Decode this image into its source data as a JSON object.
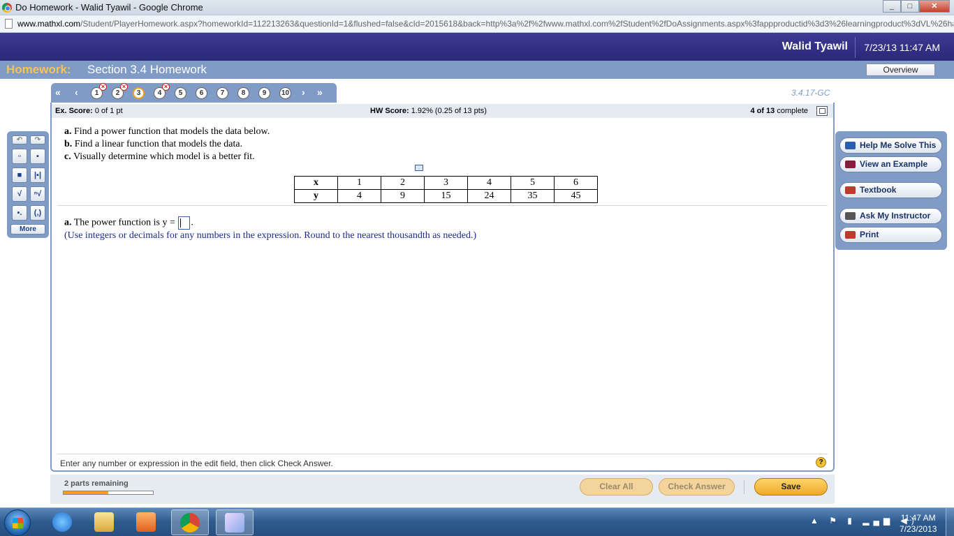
{
  "browser": {
    "window_title": "Do Homework - Walid Tyawil - Google Chrome",
    "url_domain": "www.mathxl.com",
    "url_rest": "/Student/PlayerHomework.aspx?homeworkId=112213263&questionId=1&flushed=false&cId=2015618&back=http%3a%2f%2fwww.mathxl.com%2fStudent%2fDoAssignments.aspx%3fappproductid%3d3%26learningproduct%3dVL%26ha"
  },
  "header": {
    "username": "Walid Tyawil",
    "datetime": "7/23/13 11:47 AM",
    "homework_label": "Homework:",
    "homework_title": "Section 3.4 Homework",
    "overview_label": "Overview"
  },
  "question_nav": {
    "questions": [
      {
        "label": "1",
        "status": "incorrect"
      },
      {
        "label": "2",
        "status": "incorrect"
      },
      {
        "label": "3",
        "status": "current"
      },
      {
        "label": "4",
        "status": "incorrect"
      },
      {
        "label": "5",
        "status": "unanswered"
      },
      {
        "label": "6",
        "status": "unanswered"
      },
      {
        "label": "7",
        "status": "unanswered"
      },
      {
        "label": "8",
        "status": "unanswered"
      },
      {
        "label": "9",
        "status": "unanswered"
      },
      {
        "label": "10",
        "status": "unanswered"
      }
    ],
    "question_id": "3.4.17-GC"
  },
  "score": {
    "ex_label": "Ex. Score:",
    "ex_value": "0 of 1 pt",
    "hw_label": "HW Score:",
    "hw_value": "1.92% (0.25 of 13 pts)",
    "complete_count": "4 of 13",
    "complete_word": "complete"
  },
  "question": {
    "part_a_label": "a.",
    "part_a": "Find a power function that models the data below.",
    "part_b_label": "b.",
    "part_b": "Find a linear function that models the data.",
    "part_c_label": "c.",
    "part_c": "Visually determine which model is a better fit.",
    "table": {
      "x_header": "x",
      "y_header": "y",
      "x_values": [
        "1",
        "2",
        "3",
        "4",
        "5",
        "6"
      ],
      "y_values": [
        "4",
        "9",
        "15",
        "24",
        "35",
        "45"
      ]
    },
    "answer_label": "a.",
    "answer_prefix": "The power function is y =",
    "answer_suffix": ".",
    "hint": "(Use integers or decimals for any numbers in the expression. Round to the nearest thousandth as needed.)"
  },
  "status_message": "Enter any number or expression in the edit field, then click Check Answer.",
  "math_tools": {
    "more_label": "More"
  },
  "help_panel": {
    "items": [
      {
        "label": "Help Me Solve This",
        "icon": "key-icon",
        "color": "#2a5db0"
      },
      {
        "label": "View an Example",
        "icon": "book-icon",
        "color": "#8a1c3a"
      },
      {
        "label": "Textbook",
        "icon": "textbook-icon",
        "color": "#c0392b"
      },
      {
        "label": "Ask My Instructor",
        "icon": "person-icon",
        "color": "#555555"
      },
      {
        "label": "Print",
        "icon": "printer-icon",
        "color": "#c0392b"
      }
    ]
  },
  "footer": {
    "parts_remaining": "2 parts remaining",
    "progress_fraction": 0.5,
    "clear_all": "Clear All",
    "check_answer": "Check Answer",
    "save": "Save"
  },
  "taskbar": {
    "time": "11:47 AM",
    "date": "7/23/2013"
  },
  "colors": {
    "header_blue": "#2a287a",
    "nav_blue": "#7f9bc6",
    "homework_gold": "#f6c35a",
    "hint_blue": "#1c2a8a"
  }
}
